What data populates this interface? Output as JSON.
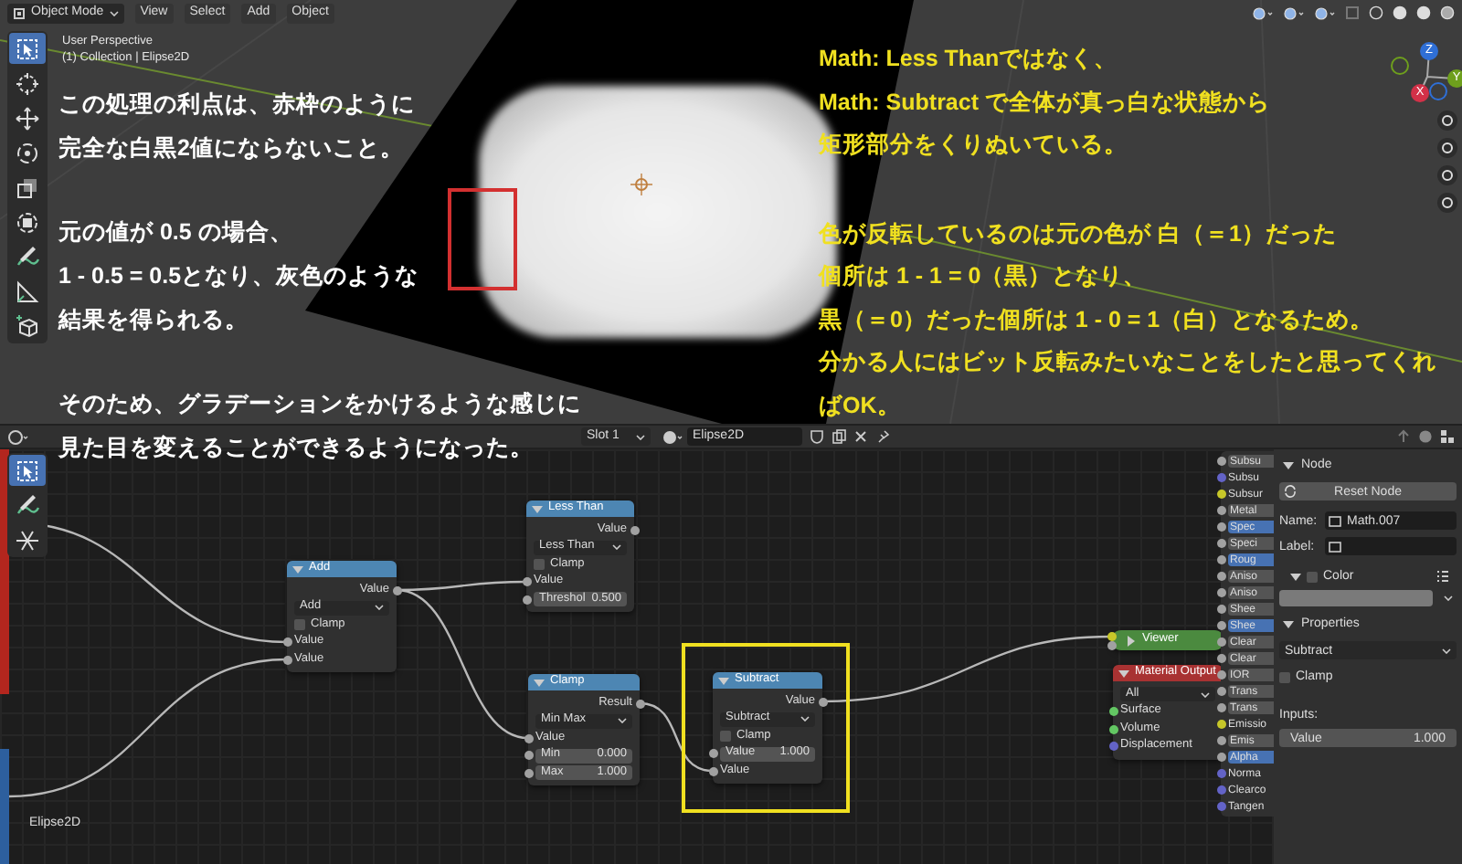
{
  "viewport": {
    "mode": "Object Mode",
    "menus": [
      "View",
      "Select",
      "Add",
      "Object"
    ],
    "info": [
      "User Perspective",
      "(1) Collection | Elipse2D"
    ],
    "axes": [
      {
        "label": "Z",
        "color": "#2f6fd6"
      },
      {
        "label": "Y",
        "color": "#6e9f1d"
      },
      {
        "label": "X",
        "color": "#d23148"
      }
    ]
  },
  "annotations": {
    "left": [
      [
        "この処理の利点は、赤枠のように",
        "完全な白黒2値にならないこと。"
      ],
      [
        "元の値が 0.5 の場合、",
        "1 - 0.5 = 0.5となり、灰色のような",
        "結果を得られる。"
      ],
      [
        "そのため、グラデーションをかけるような感じに",
        "見た目を変えることができるようになった。"
      ]
    ],
    "right": [
      [
        "Math: Less Thanではなく、",
        "Math: Subtract で全体が真っ白な状態から",
        "矩形部分をくりぬいている。"
      ],
      [
        "色が反転しているのは元の色が 白（＝1）だった",
        "個所は 1 - 1 = 0（黒）となり、",
        "黒（＝0）だった個所は 1 - 0 = 1（白）となるため。",
        "分かる人にはビット反転みたいなことをしたと思ってくれ",
        "ばOK。"
      ]
    ]
  },
  "node_editor": {
    "slot": "Slot 1",
    "material": "Elipse2D",
    "object_name": "Elipse2D",
    "nodes": [
      {
        "title": "Add",
        "color": "#4d86b3",
        "highlighted": false,
        "collapsed": false,
        "rows": [
          {
            "kind": "output",
            "label": "Value",
            "color": "#a1a1a1"
          },
          {
            "kind": "dropdown",
            "label": "Add"
          },
          {
            "kind": "checkbox",
            "label": "Clamp",
            "checked": false
          },
          {
            "kind": "input",
            "label": "Value",
            "color": "#a1a1a1"
          },
          {
            "kind": "input",
            "label": "Value",
            "color": "#a1a1a1"
          }
        ]
      },
      {
        "title": "Less Than",
        "color": "#4d86b3",
        "highlighted": false,
        "collapsed": false,
        "rows": [
          {
            "kind": "output",
            "label": "Value",
            "color": "#a1a1a1"
          },
          {
            "kind": "dropdown",
            "label": "Less Than"
          },
          {
            "kind": "checkbox",
            "label": "Clamp",
            "checked": false
          },
          {
            "kind": "input",
            "label": "Value",
            "color": "#a1a1a1"
          },
          {
            "kind": "field",
            "label": "Threshol",
            "value": "0.500",
            "color": "#a1a1a1"
          }
        ]
      },
      {
        "title": "Clamp",
        "color": "#4d86b3",
        "highlighted": false,
        "collapsed": false,
        "rows": [
          {
            "kind": "output",
            "label": "Result",
            "color": "#a1a1a1"
          },
          {
            "kind": "dropdown",
            "label": "Min Max"
          },
          {
            "kind": "input",
            "label": "Value",
            "color": "#a1a1a1"
          },
          {
            "kind": "field",
            "label": "Min",
            "value": "0.000",
            "color": "#a1a1a1"
          },
          {
            "kind": "field",
            "label": "Max",
            "value": "1.000",
            "color": "#a1a1a1"
          }
        ]
      },
      {
        "title": "Subtract",
        "color": "#4d86b3",
        "highlighted": true,
        "collapsed": false,
        "rows": [
          {
            "kind": "output",
            "label": "Value",
            "color": "#a1a1a1"
          },
          {
            "kind": "dropdown",
            "label": "Subtract"
          },
          {
            "kind": "checkbox",
            "label": "Clamp",
            "checked": false
          },
          {
            "kind": "field",
            "label": "Value",
            "value": "1.000",
            "color": "#a1a1a1"
          },
          {
            "kind": "input",
            "label": "Value",
            "color": "#a1a1a1"
          }
        ]
      },
      {
        "title": "Viewer",
        "color": "#4b8a3f",
        "highlighted": false,
        "collapsed": true,
        "rows": [
          {
            "kind": "input",
            "color": "#c7c729"
          },
          {
            "kind": "input",
            "color": "#a1a1a1"
          },
          {
            "kind": "output",
            "color": "#a1a1a1"
          }
        ]
      },
      {
        "title": "Material Output",
        "color": "#a83232",
        "highlighted": false,
        "collapsed": false,
        "rows": [
          {
            "kind": "dropdown",
            "label": "All"
          },
          {
            "kind": "input",
            "label": "Surface",
            "color": "#63c763"
          },
          {
            "kind": "input",
            "label": "Volume",
            "color": "#63c763"
          },
          {
            "kind": "input",
            "label": "Displacement",
            "color": "#6363c7"
          }
        ]
      }
    ],
    "bsdf_inputs": [
      {
        "kind": "field",
        "label": "Subsu",
        "color": "#a1a1a1",
        "filled": false
      },
      {
        "kind": "socket",
        "label": "Subsu",
        "color": "#6363c7"
      },
      {
        "kind": "socket",
        "label": "Subsur",
        "color": "#c7c729"
      },
      {
        "kind": "field",
        "label": "Metal",
        "color": "#a1a1a1",
        "filled": false
      },
      {
        "kind": "field",
        "label": "Spec",
        "color": "#a1a1a1",
        "filled": true
      },
      {
        "kind": "field",
        "label": "Speci",
        "color": "#a1a1a1",
        "filled": false
      },
      {
        "kind": "field",
        "label": "Roug",
        "color": "#a1a1a1",
        "filled": true
      },
      {
        "kind": "field",
        "label": "Aniso",
        "color": "#a1a1a1",
        "filled": false
      },
      {
        "kind": "field",
        "label": "Aniso",
        "color": "#a1a1a1",
        "filled": false
      },
      {
        "kind": "field",
        "label": "Shee",
        "color": "#a1a1a1",
        "filled": false
      },
      {
        "kind": "field",
        "label": "Shee",
        "color": "#a1a1a1",
        "filled": true
      },
      {
        "kind": "field",
        "label": "Clear",
        "color": "#a1a1a1",
        "filled": false
      },
      {
        "kind": "field",
        "label": "Clear",
        "color": "#a1a1a1",
        "filled": false
      },
      {
        "kind": "field",
        "label": "IOR",
        "color": "#a1a1a1",
        "filled": false
      },
      {
        "kind": "field",
        "label": "Trans",
        "color": "#a1a1a1",
        "filled": false
      },
      {
        "kind": "field",
        "label": "Trans",
        "color": "#a1a1a1",
        "filled": false
      },
      {
        "kind": "socket",
        "label": "Emissio",
        "color": "#c7c729"
      },
      {
        "kind": "field",
        "label": "Emis",
        "color": "#a1a1a1",
        "filled": false
      },
      {
        "kind": "field",
        "label": "Alpha",
        "color": "#a1a1a1",
        "filled": true
      },
      {
        "kind": "socket",
        "label": "Norma",
        "color": "#6363c7"
      },
      {
        "kind": "socket",
        "label": "Clearco",
        "color": "#6363c7"
      },
      {
        "kind": "socket",
        "label": "Tangen",
        "color": "#6363c7"
      }
    ],
    "sidebar": {
      "node_section": "Node",
      "node_expanded": true,
      "reset_button": "Reset Node",
      "name_label": "Name:",
      "name_value": "Math.007",
      "label_label": "Label:",
      "color_label": "Color",
      "color_expanded": true,
      "color_checked": false,
      "properties_section": "Properties",
      "properties_expanded": true,
      "operation": "Subtract",
      "clamp_label": "Clamp",
      "clamp_checked": false,
      "inputs_label": "Inputs:",
      "input_label": "Value",
      "input_value": "1.000"
    }
  }
}
